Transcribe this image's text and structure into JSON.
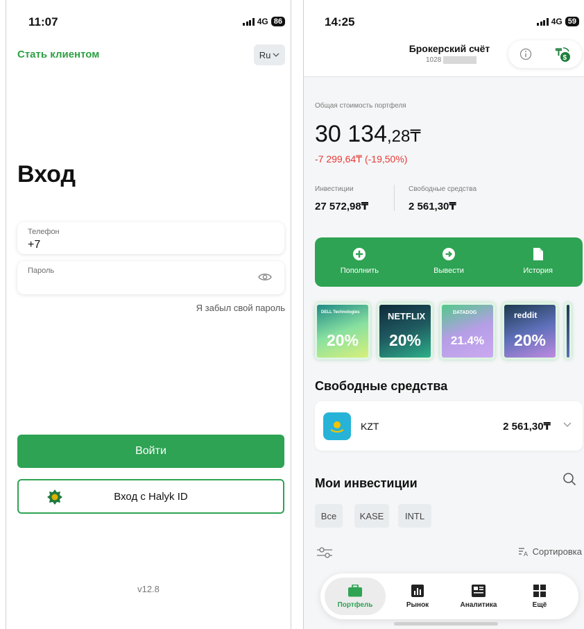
{
  "left": {
    "status": {
      "time": "11:07",
      "network": "4G",
      "battery": "86"
    },
    "become_client": "Стать клиентом",
    "language": "Ru",
    "title": "Вход",
    "phone_label": "Телефон",
    "phone_value": "+7",
    "password_label": "Пароль",
    "forgot": "Я забыл свой пароль",
    "login_button": "Войти",
    "halyk_button": "Вход с Halyk ID",
    "version": "v12.8"
  },
  "right": {
    "status": {
      "time": "14:25",
      "network": "4G",
      "battery": "59"
    },
    "account_title": "Брокерский счёт",
    "account_number": "1028",
    "portfolio_label": "Общая стоимость портфеля",
    "total_int": "30 134",
    "total_dec": ",28₸",
    "change": "-7 299,64₸ (-19,50%)",
    "investments_label": "Инвестиции",
    "investments_value": "27 572,98₸",
    "free_label": "Свободные средства",
    "free_value": "2 561,30₸",
    "actions": {
      "topup": "Пополнить",
      "withdraw": "Вывести",
      "history": "История"
    },
    "stories": [
      {
        "brand": "DELL Technologies",
        "pct": "20%"
      },
      {
        "brand": "NETFLIX",
        "pct": "20%"
      },
      {
        "brand": "DATADOG",
        "pct": "21.4%"
      },
      {
        "brand": "reddit",
        "pct": "20%"
      }
    ],
    "free_section_title": "Свободные средства",
    "currency_code": "KZT",
    "currency_value": "2 561,30₸",
    "investments_title": "Мои инвестиции",
    "chips": {
      "all": "Все",
      "kase": "KASE",
      "intl": "INTL"
    },
    "sort": "Сортировка",
    "nav": {
      "portfolio": "Портфель",
      "market": "Рынок",
      "analytics": "Аналитика",
      "more": "Ещё"
    },
    "colors": {
      "accent": "#2ea353",
      "negative": "#e53935"
    }
  }
}
